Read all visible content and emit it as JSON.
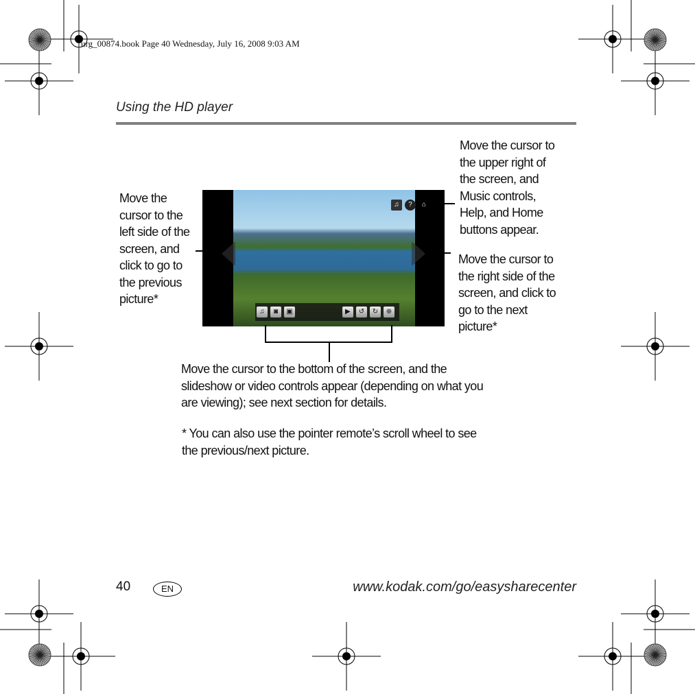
{
  "slug": "urg_00874.book  Page 40  Wednesday, July 16, 2008  9:03 AM",
  "header": {
    "title": "Using the HD player"
  },
  "callouts": {
    "left": [
      "Move the",
      "cursor to the",
      "left side of the",
      "screen, and",
      "click to go to",
      "the previous",
      "picture*"
    ],
    "top_right": [
      "Move the cursor to",
      "the upper right of",
      "the screen, and",
      "Music controls,",
      "Help, and Home",
      "buttons appear."
    ],
    "right": [
      "Move the cursor to",
      "the right side of the",
      "screen, and click to",
      "go to the next",
      "picture*"
    ],
    "bottom": [
      "Move the cursor to the bottom of the screen, and the",
      "slideshow or video controls appear (depending on what you",
      "are viewing); see next section for details."
    ]
  },
  "footnote": [
    "* You can also use the pointer remote’s scroll wheel to see",
    "the previous/next picture."
  ],
  "screen": {
    "top_icons": [
      "music-icon",
      "help-icon",
      "home-icon"
    ],
    "bottom_left_icons": [
      "music-icon",
      "camera-icon",
      "slideshow-icon"
    ],
    "bottom_right_icons": [
      "play-icon",
      "rotate-left-icon",
      "rotate-right-icon",
      "zoom-icon"
    ]
  },
  "footer": {
    "page_number": "40",
    "language": "EN",
    "url": "www.kodak.com/go/easysharecenter"
  }
}
